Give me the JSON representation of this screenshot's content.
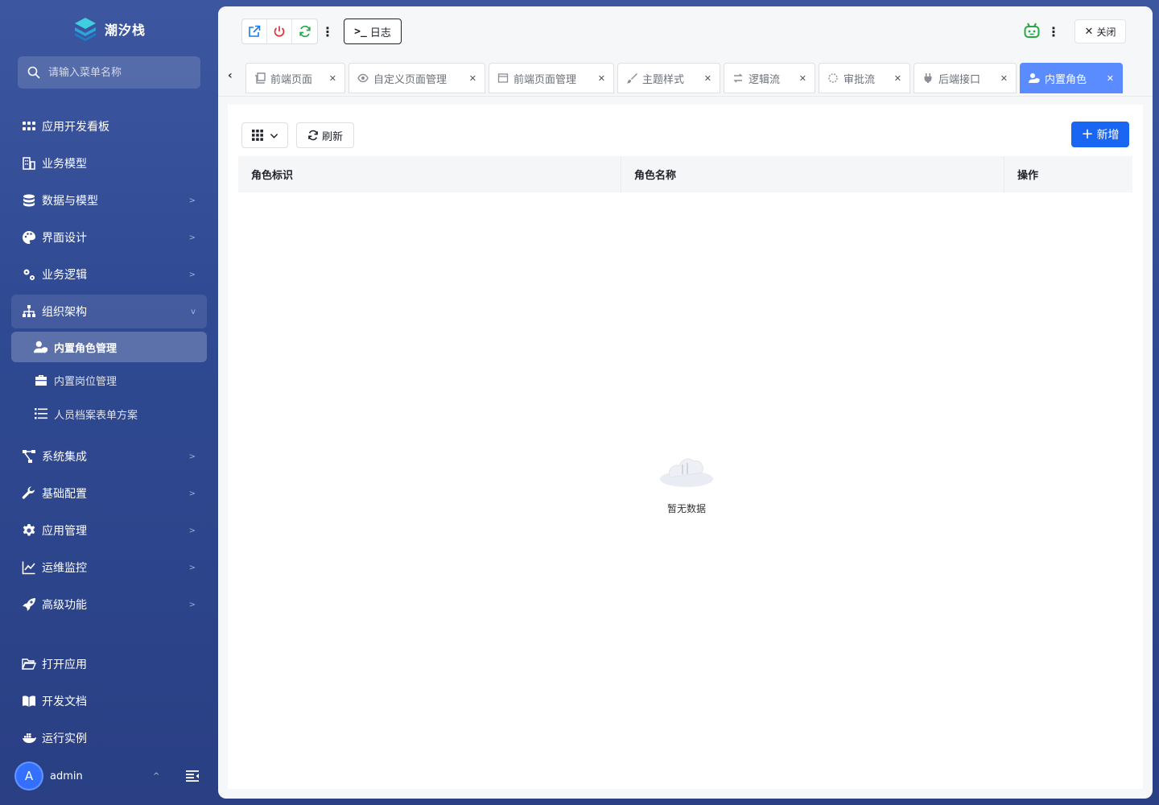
{
  "brand": {
    "name": "潮汐栈"
  },
  "search": {
    "placeholder": "请输入菜单名称"
  },
  "menu": [
    {
      "label": "应用开发看板",
      "icon": "grid-icon"
    },
    {
      "label": "业务模型",
      "icon": "building-icon"
    },
    {
      "label": "数据与模型",
      "icon": "database-icon"
    },
    {
      "label": "界面设计",
      "icon": "palette-icon"
    },
    {
      "label": "业务逻辑",
      "icon": "gears-icon"
    },
    {
      "label": "组织架构",
      "icon": "sitemap-icon"
    },
    {
      "label": "系统集成",
      "icon": "network-icon"
    },
    {
      "label": "基础配置",
      "icon": "wrench-icon"
    },
    {
      "label": "应用管理",
      "icon": "gear-icon"
    },
    {
      "label": "运维监控",
      "icon": "line-chart-icon"
    },
    {
      "label": "高级功能",
      "icon": "rocket-icon"
    }
  ],
  "submenu": [
    {
      "label": "内置角色管理",
      "icon": "user-shield-icon"
    },
    {
      "label": "内置岗位管理",
      "icon": "briefcase-icon"
    },
    {
      "label": "人员档案表单方案",
      "icon": "list-icon"
    }
  ],
  "bottom_menu": [
    {
      "label": "打开应用",
      "icon": "folder-open-icon"
    },
    {
      "label": "开发文档",
      "icon": "book-icon"
    },
    {
      "label": "运行实例",
      "icon": "docker-icon"
    }
  ],
  "user": {
    "avatar_letter": "A",
    "name": "admin"
  },
  "toolbar": {
    "log_label": "日志",
    "close_label": "关闭"
  },
  "tabs": [
    {
      "label": "前端页面",
      "icon": "copy-icon"
    },
    {
      "label": "自定义页面管理",
      "icon": "eye-icon"
    },
    {
      "label": "前端页面管理",
      "icon": "window-icon"
    },
    {
      "label": "主题样式",
      "icon": "brush-icon"
    },
    {
      "label": "逻辑流",
      "icon": "flow-icon"
    },
    {
      "label": "审批流",
      "icon": "spinner-icon"
    },
    {
      "label": "后端接口",
      "icon": "plug-icon"
    },
    {
      "label": "内置角色",
      "icon": "user-shield-icon",
      "active": true
    }
  ],
  "content": {
    "refresh_label": "刷新",
    "add_label": "新增",
    "columns": [
      "角色标识",
      "角色名称",
      "操作"
    ],
    "empty_text": "暂无数据"
  },
  "colors": {
    "primary": "#1a66f2",
    "active_tab": "#5b8cff",
    "sidebar_bg": "#3d56a0"
  }
}
